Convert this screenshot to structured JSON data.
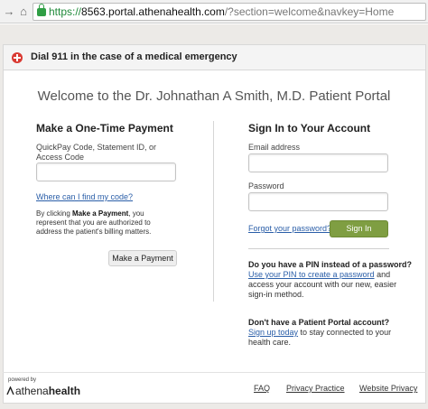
{
  "browser": {
    "url_scheme": "https://",
    "url_host": "8563.portal.athenahealth.com",
    "url_rest": "/?section=welcome&navkey=Home"
  },
  "emergency": {
    "text": "Dial 911 in the case of a medical emergency"
  },
  "welcome": {
    "title": "Welcome to the Dr. Johnathan A Smith, M.D. Patient Portal"
  },
  "payment": {
    "heading": "Make a One-Time Payment",
    "code_label_1": "QuickPay Code, Statement ID, or",
    "code_label_2": "Access Code",
    "find_code_link": "Where can I find my code?",
    "consent_1_pre": "By clicking ",
    "consent_1_bold": "Make a Payment",
    "consent_1_post": ", you",
    "consent_2": "represent that you are authorized to",
    "consent_3": "address the patient's billing matters.",
    "button": "Make a Payment"
  },
  "signin": {
    "heading": "Sign In to Your Account",
    "email_label": "Email address",
    "password_label": "Password",
    "forgot_link": "Forgot your password?",
    "button": "Sign In",
    "pin_question": "Do you have a PIN instead of a password?",
    "pin_link": "Use your PIN to create a password",
    "pin_rest": " and access your account with our new, easier sign-in method.",
    "no_account_question": "Don't have a Patient Portal account?",
    "signup_link": "Sign up today",
    "signup_rest": " to stay connected to your health care."
  },
  "footer": {
    "powered_by": "powered by",
    "logo_part1": "athena",
    "logo_part2": "health",
    "faq": "FAQ",
    "privacy_practice": "Privacy Practice",
    "website_privacy": "Website Privacy"
  }
}
